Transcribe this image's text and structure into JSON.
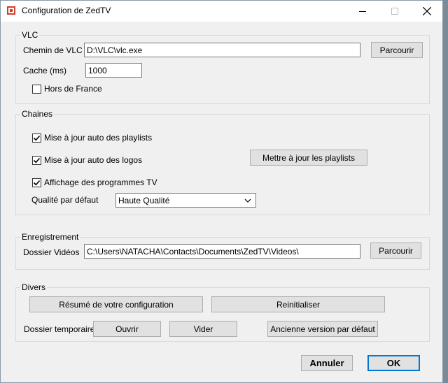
{
  "window": {
    "title": "Configuration de ZedTV"
  },
  "vlc": {
    "legend": "VLC",
    "path_label": "Chemin de VLC",
    "path_value": "D:\\VLC\\vlc.exe",
    "browse_label": "Parcourir",
    "cache_label": "Cache (ms)",
    "cache_value": "1000",
    "outside_france_label": "Hors de France",
    "outside_france_checked": false
  },
  "chaines": {
    "legend": "Chaines",
    "auto_playlists_label": "Mise à jour auto des playlists",
    "auto_playlists_checked": true,
    "auto_logos_label": "Mise à jour auto des logos",
    "auto_logos_checked": true,
    "tv_programs_label": "Affichage des programmes TV",
    "tv_programs_checked": true,
    "update_playlists_label": "Mettre à jour les playlists",
    "quality_label": "Qualité par défaut",
    "quality_value": "Haute Qualité"
  },
  "enregistrement": {
    "legend": "Enregistrement",
    "folder_label": "Dossier Vidéos",
    "folder_value": "C:\\Users\\NATACHA\\Contacts\\Documents\\ZedTV\\Videos\\",
    "browse_label": "Parcourir"
  },
  "divers": {
    "legend": "Divers",
    "summary_label": "Résumé de votre configuration",
    "reset_label": "Reinitialiser",
    "temp_label": "Dossier temporaire :",
    "open_label": "Ouvrir",
    "empty_label": "Vider",
    "old_version_label": "Ancienne version par défaut"
  },
  "footer": {
    "cancel_label": "Annuler",
    "ok_label": "OK"
  }
}
